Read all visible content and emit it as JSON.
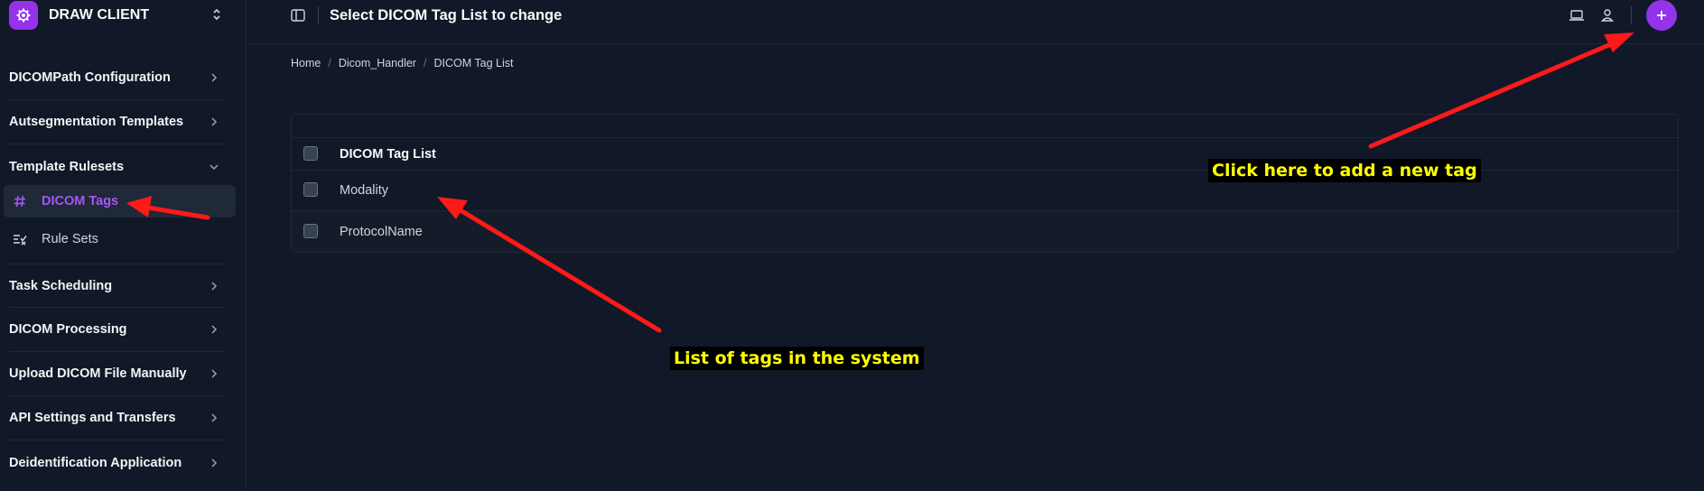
{
  "app": {
    "name": "DRAW CLIENT"
  },
  "sidebar": {
    "groups": [
      {
        "label": "DICOMPath Configuration"
      },
      {
        "label": "Autsegmentation Templates"
      },
      {
        "label": "Template Rulesets"
      },
      {
        "label": "Task Scheduling"
      },
      {
        "label": "DICOM Processing"
      },
      {
        "label": "Upload DICOM File Manually"
      },
      {
        "label": "API Settings and Transfers"
      },
      {
        "label": "Deidentification Application"
      }
    ],
    "sub_items": [
      {
        "label": "DICOM Tags",
        "icon": "hash-icon",
        "active": true
      },
      {
        "label": "Rule Sets",
        "icon": "list-check-icon",
        "active": false
      }
    ]
  },
  "header": {
    "title": "Select DICOM Tag List to change"
  },
  "breadcrumb": {
    "items": [
      "Home",
      "Dicom_Handler",
      "DICOM Tag List"
    ],
    "separator": "/"
  },
  "table": {
    "header": "DICOM Tag List",
    "rows": [
      "Modality",
      "ProtocolName"
    ]
  },
  "annotations": {
    "add_note": "Click here to add a new tag",
    "list_note": "List of tags in the system"
  },
  "colors": {
    "accent": "#9333ea",
    "active_text": "#a855f7",
    "background": "#111827",
    "annotation_arrow": "#ff0000",
    "annotation_text": "#ffff00"
  }
}
